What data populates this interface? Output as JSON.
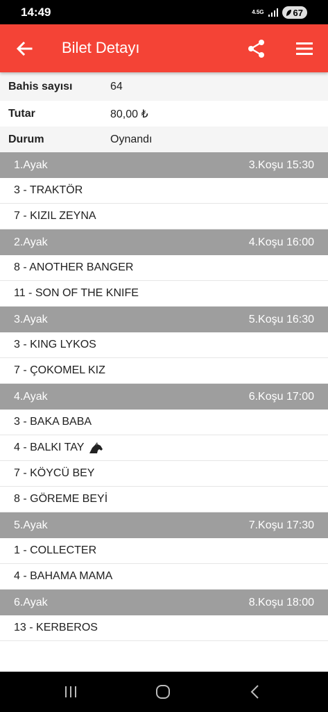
{
  "status": {
    "time": "14:49",
    "network": "4.5G",
    "battery": "67"
  },
  "appbar": {
    "title": "Bilet Detayı"
  },
  "info": [
    {
      "label": "Bahis sayısı",
      "value": "64"
    },
    {
      "label": "Tutar",
      "value": "80,00 ₺"
    },
    {
      "label": "Durum",
      "value": "Oynandı"
    }
  ],
  "legs": [
    {
      "leg": "1.Ayak",
      "race": "3.Koşu 15:30",
      "horses": [
        "3 - TRAKTÖR",
        "7 - KIZIL ZEYNA"
      ]
    },
    {
      "leg": "2.Ayak",
      "race": "4.Koşu 16:00",
      "horses": [
        "8 - ANOTHER BANGER",
        "11 - SON OF THE KNIFE"
      ]
    },
    {
      "leg": "3.Ayak",
      "race": "5.Koşu 16:30",
      "horses": [
        "3 - KING LYKOS",
        "7 - ÇOKOMEL KIZ"
      ]
    },
    {
      "leg": "4.Ayak",
      "race": "6.Koşu 17:00",
      "horses": [
        "3 - BAKA BABA",
        "4 - BALKI TAY",
        "7 - KÖYCÜ BEY",
        "8 - GÖREME BEYİ"
      ]
    },
    {
      "leg": "5.Ayak",
      "race": "7.Koşu 17:30",
      "horses": [
        "1 - COLLECTER",
        "4 - BAHAMA MAMA"
      ]
    },
    {
      "leg": "6.Ayak",
      "race": "8.Koşu 18:00",
      "horses": [
        "13 - KERBEROS"
      ]
    }
  ],
  "icons": {
    "back": "arrow-left-icon",
    "share": "share-icon",
    "menu": "hamburger-menu-icon",
    "winner": "horse-head-icon"
  },
  "colors": {
    "appbar": "#f44336",
    "leg_header": "#9e9e9e"
  }
}
